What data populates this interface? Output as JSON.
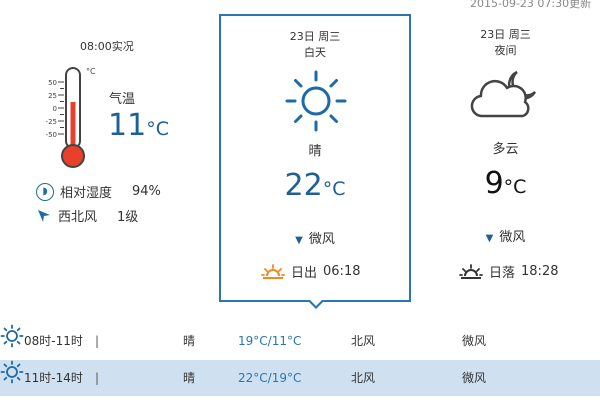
{
  "header": {
    "update_time": "2015-09-23 07:30更新"
  },
  "live": {
    "title": "08:00实况",
    "temp_label": "气温",
    "temp_value": "11",
    "temp_unit": "°C",
    "thermo_unit": "°C",
    "scale": [
      "50",
      "25",
      "0",
      "-25",
      "-50"
    ],
    "humidity_label": "相对湿度",
    "humidity_value": "94%",
    "wind_dir": "西北风",
    "wind_level": "1级"
  },
  "day": {
    "date": "23日 周三",
    "period": "白天",
    "condition": "晴",
    "temp": "22",
    "temp_unit": "°C",
    "wind": "微风",
    "sun_label": "日出",
    "sun_time": "06:18"
  },
  "night": {
    "date": "23日 周三",
    "period": "夜间",
    "condition": "多云",
    "temp": "9",
    "temp_unit": "°C",
    "wind": "微风",
    "sun_label": "日落",
    "sun_time": "18:28"
  },
  "hourly": [
    {
      "time": "08时-11时",
      "sep": "|",
      "icon": "sun-icon",
      "condition": "晴",
      "temp": "19°C/11°C",
      "wind_dir": "北风",
      "wind_level": "微风"
    },
    {
      "time": "11时-14时",
      "sep": "|",
      "icon": "sun-icon",
      "condition": "晴",
      "temp": "22°C/19°C",
      "wind_dir": "北风",
      "wind_level": "微风"
    }
  ],
  "colors": {
    "accent": "#2a76b4",
    "temp_blue": "#1e5f97",
    "thermo_red": "#e8402a",
    "sun_orange": "#f08a1c",
    "row_highlight": "#cfe0f1"
  }
}
